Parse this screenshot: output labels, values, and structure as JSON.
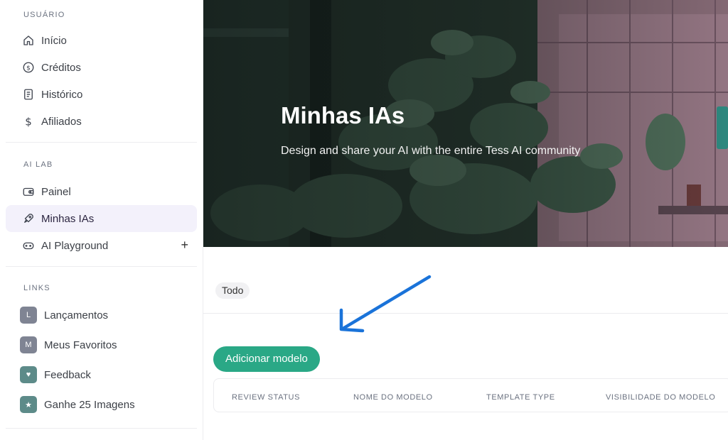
{
  "sidebar": {
    "user_section": {
      "header": "USUÁRIO",
      "items": [
        {
          "label": "Início",
          "icon": "home-icon"
        },
        {
          "label": "Créditos",
          "icon": "dollar-circle-icon"
        },
        {
          "label": "Histórico",
          "icon": "document-icon"
        },
        {
          "label": "Afiliados",
          "icon": "dollar-icon"
        }
      ]
    },
    "ai_lab_section": {
      "header": "AI LAB",
      "items": [
        {
          "label": "Painel",
          "icon": "wallet-icon"
        },
        {
          "label": "Minhas IAs",
          "icon": "rocket-icon",
          "active": true
        },
        {
          "label": "AI Playground",
          "icon": "gamepad-icon"
        }
      ],
      "plus_label": "+"
    },
    "links_section": {
      "header": "LINKS",
      "items": [
        {
          "label": "Lançamentos",
          "badge": "L"
        },
        {
          "label": "Meus Favoritos",
          "badge": "M"
        },
        {
          "label": "Feedback",
          "badge": "♥"
        },
        {
          "label": "Ganhe 25 Imagens",
          "badge": "★"
        }
      ]
    }
  },
  "hero": {
    "title": "Minhas IAs",
    "subtitle": "Design and share your AI with the entire Tess AI community"
  },
  "filter": {
    "label": "Todo"
  },
  "add_button": {
    "label": "Adicionar modelo"
  },
  "table": {
    "columns": [
      "REVIEW STATUS",
      "NOME DO MODELO",
      "TEMPLATE TYPE",
      "VISIBILIDADE DO MODELO"
    ]
  },
  "colors": {
    "accent": "#2aa886",
    "active_bg": "#f3f1fb",
    "arrow": "#1a73d9"
  }
}
